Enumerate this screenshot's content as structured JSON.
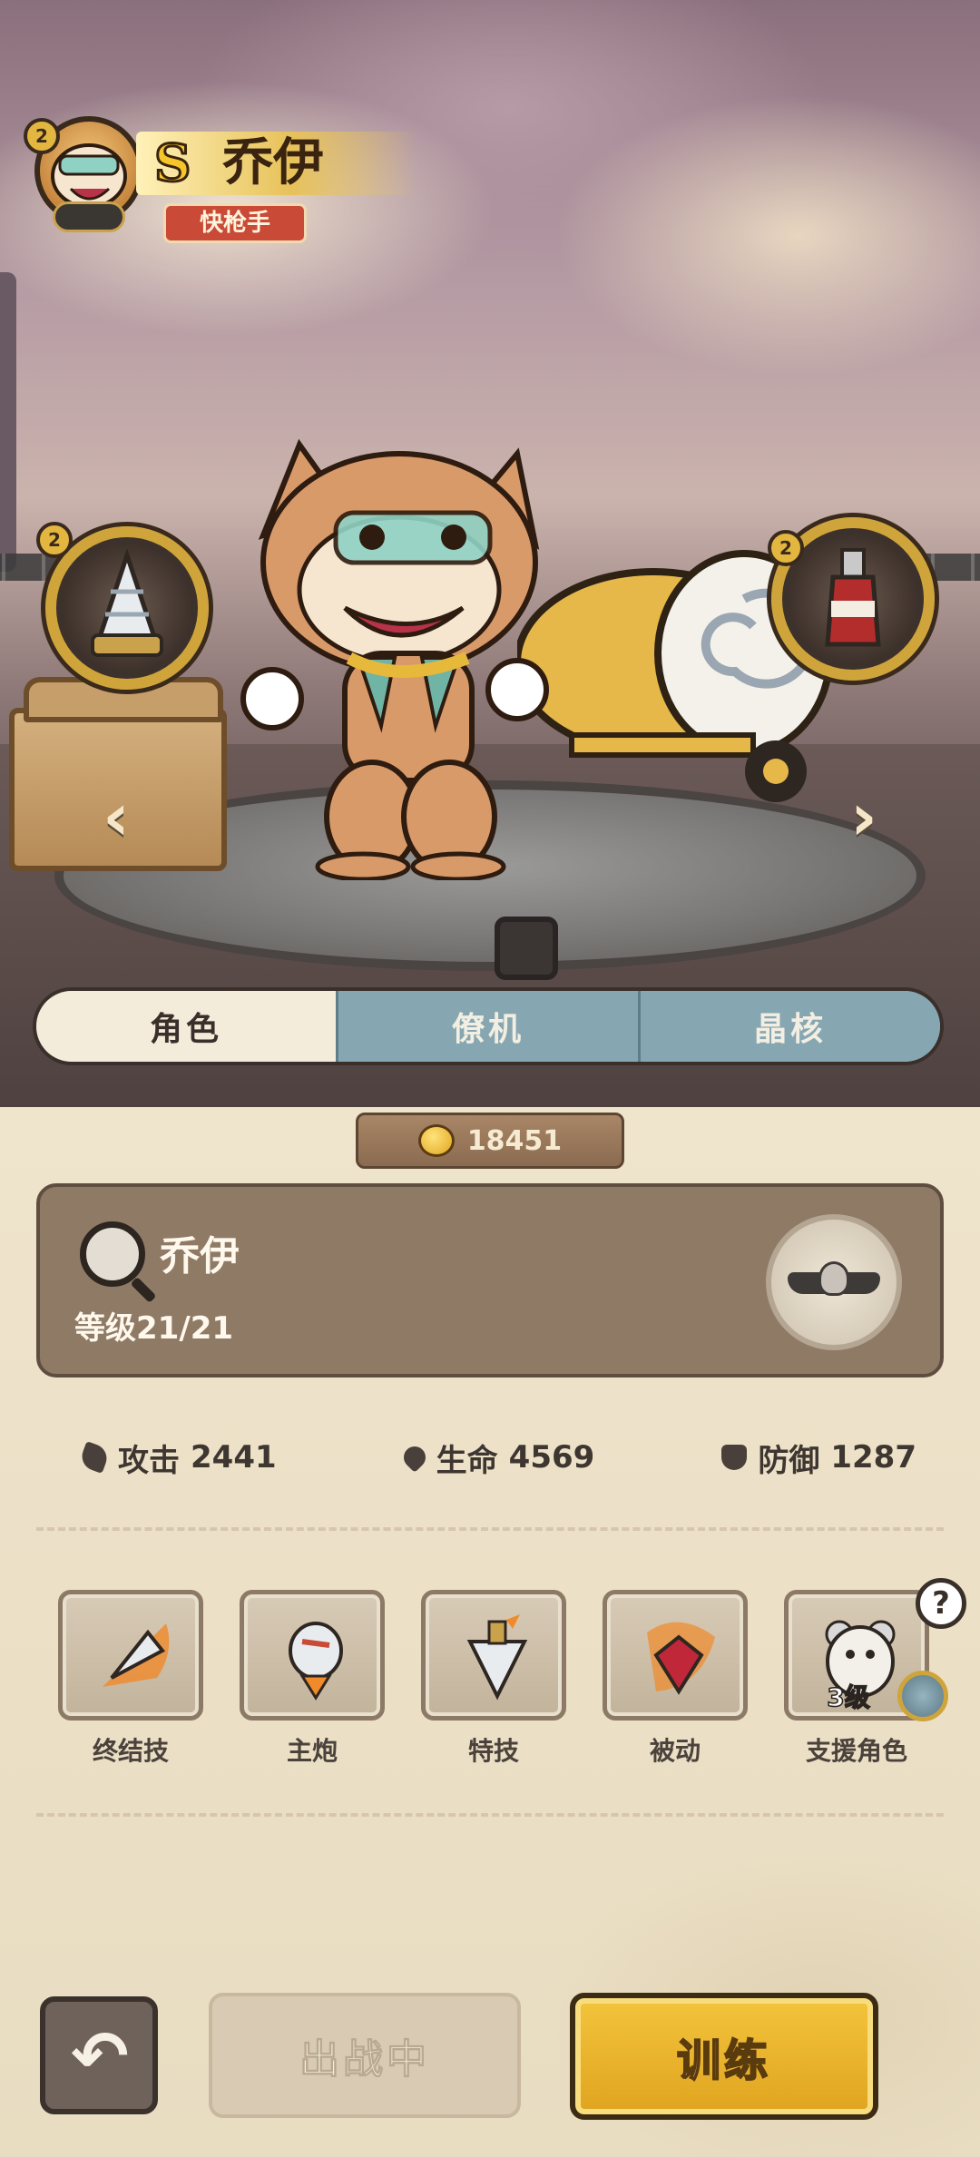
{
  "character": {
    "rank": "S",
    "name": "乔伊",
    "class_tag": "快枪手",
    "portrait_level": "2",
    "left_orb_level": "2",
    "right_orb_level": "2"
  },
  "tabs": [
    {
      "label": "角色",
      "active": true
    },
    {
      "label": "僚机",
      "active": false
    },
    {
      "label": "晶核",
      "active": false
    }
  ],
  "currency": {
    "amount": "18451",
    "icon": "coin-fist-icon"
  },
  "info_card": {
    "name": "乔伊",
    "level_text": "等级21/21"
  },
  "stats": [
    {
      "label": "攻击",
      "value": "2441",
      "icon": "attack-icon"
    },
    {
      "label": "生命",
      "value": "4569",
      "icon": "heart-icon"
    },
    {
      "label": "防御",
      "value": "1287",
      "icon": "shield-icon"
    }
  ],
  "skills": [
    {
      "label": "终结技",
      "icon": "ultimate-drill-icon"
    },
    {
      "label": "主炮",
      "icon": "main-cannon-icon"
    },
    {
      "label": "特技",
      "icon": "special-drill-icon"
    },
    {
      "label": "被动",
      "icon": "passive-gem-icon"
    },
    {
      "label": "支援角色",
      "icon": "support-hamster-icon",
      "level": "3级"
    }
  ],
  "buttons": {
    "deploy": "出战中",
    "train": "训练"
  },
  "colors": {
    "accent_gold": "#e3b640",
    "tab_blue": "#86a7b2",
    "train_yellow": "#f3c43c",
    "class_red": "#c94a36"
  }
}
